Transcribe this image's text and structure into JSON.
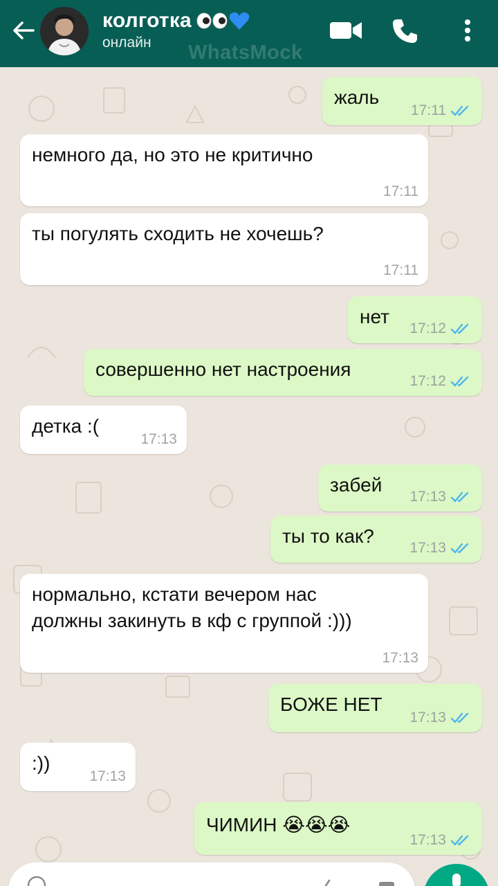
{
  "header": {
    "contact_name": "колготка",
    "contact_status": "онлайн",
    "watermark": "WhatsMock",
    "title_decor_icons": [
      "eyes-emoji-icon",
      "blue-heart-emoji-icon"
    ],
    "actions": [
      "video-call-icon",
      "phone-call-icon",
      "more-vert-icon"
    ]
  },
  "colors": {
    "header_bg": "#075e54",
    "chat_bg": "#ece5dd",
    "incoming_bubble": "#ffffff",
    "outgoing_bubble": "#dcf8c6",
    "read_tick": "#4fb6ec",
    "fab": "#00a884"
  },
  "messages": [
    {
      "dir": "out",
      "text": "жаль",
      "time": "17:11",
      "status": "read"
    },
    {
      "dir": "in",
      "text": "немного да, но это не критично",
      "time": "17:11"
    },
    {
      "dir": "in",
      "text": "ты погулять сходить не хочешь?",
      "time": "17:11"
    },
    {
      "dir": "out",
      "text": "нет",
      "time": "17:12",
      "status": "read"
    },
    {
      "dir": "out",
      "text": "совершенно нет настроения",
      "time": "17:12",
      "status": "read"
    },
    {
      "dir": "in",
      "text": "детка :(",
      "time": "17:13"
    },
    {
      "dir": "out",
      "text": "забей",
      "time": "17:13",
      "status": "read"
    },
    {
      "dir": "out",
      "text": "ты то как?",
      "time": "17:13",
      "status": "read"
    },
    {
      "dir": "in",
      "text": "нормально, кстати вечером нас\nдолжны закинуть в кф с группой :)))",
      "time": "17:13"
    },
    {
      "dir": "out",
      "text": "БОЖЕ НЕТ",
      "time": "17:13",
      "status": "read"
    },
    {
      "dir": "in",
      "text": ":))",
      "time": "17:13"
    },
    {
      "dir": "out",
      "text": "ЧИМИН 😭😭😭",
      "time": "17:13",
      "status": "read"
    }
  ],
  "input": {
    "icons": [
      "emoji-icon",
      "attach-icon",
      "camera-icon",
      "mic-icon"
    ]
  }
}
